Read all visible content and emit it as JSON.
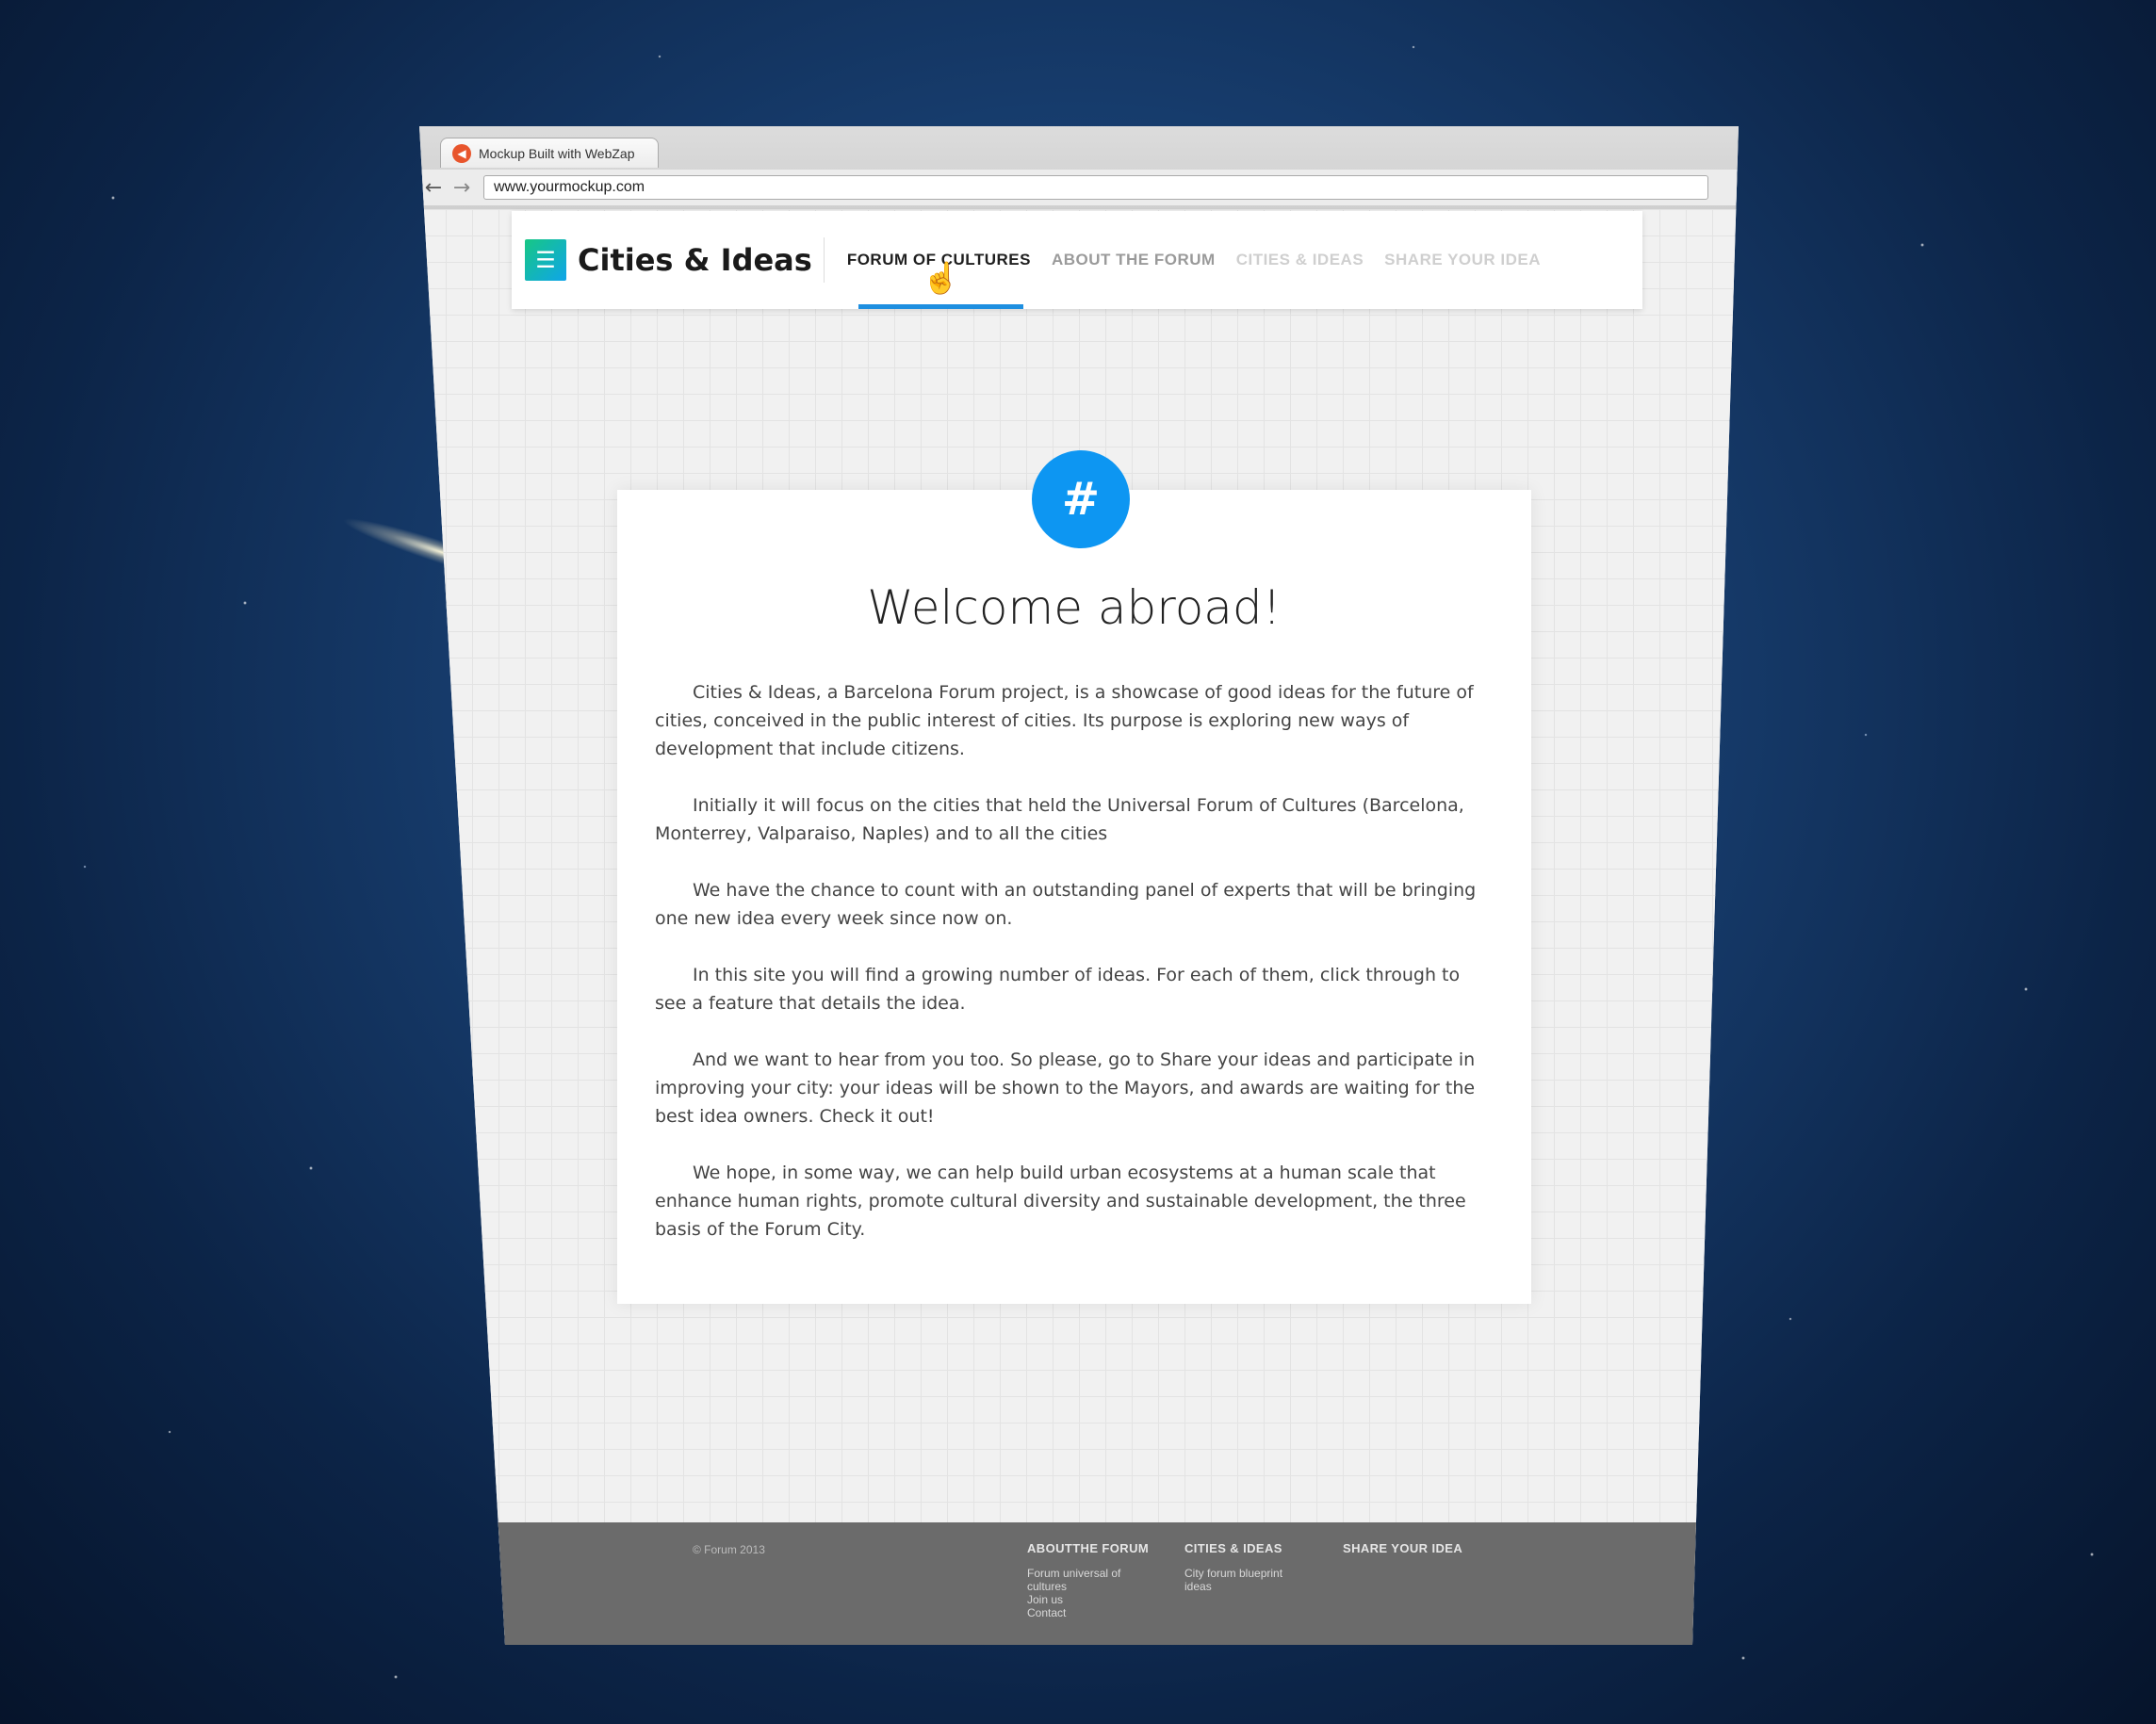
{
  "browser": {
    "tab_title": "Mockup Built with WebZap",
    "url": "www.yourmockup.com",
    "back_glyph": "←",
    "forward_glyph": "→"
  },
  "site": {
    "logo_text": "Cities & Ideas",
    "nav": [
      {
        "label": "FORUM OF CULTURES",
        "state": "active"
      },
      {
        "label": "ABOUT THE FORUM",
        "state": "normal"
      },
      {
        "label": "CITIES & IDEAS",
        "state": "faded"
      },
      {
        "label": "SHARE YOUR IDEA",
        "state": "faded"
      }
    ],
    "accent_color": "#1e8fe0"
  },
  "card": {
    "badge": "#",
    "heading": "Welcome abroad!",
    "paragraphs": [
      "Cities & Ideas, a Barcelona Forum project, is a showcase of good ideas for the future of cities, conceived in the public interest of cities. Its purpose is exploring new ways of development that include citizens.",
      "Initially it will focus on the cities that held the Universal Forum of Cultures (Barcelona, Monterrey, Valparaiso, Naples) and to all the cities",
      "We have the chance to count with an outstanding panel of experts that will be bringing one new idea every week since now on.",
      "In this site you will find a growing number of ideas. For each of them, click through to see a feature that details the idea.",
      "And we want to hear from you too. So please, go to Share your ideas and participate in improving your city: your ideas will be shown to the Mayors, and awards are waiting for the best idea owners. Check it out!",
      "We hope, in some way, we can help build urban ecosystems at a human scale that enhance human rights, promote cultural diversity and sustainable development, the three basis of the Forum City."
    ]
  },
  "footer": {
    "copyright": "© Forum 2013",
    "columns": [
      {
        "title": "ABOUTTHE FORUM",
        "links": [
          "Forum universal of cultures",
          "Join us",
          "Contact"
        ]
      },
      {
        "title": "CITIES & IDEAS",
        "links": [
          "City forum blueprint ideas"
        ]
      },
      {
        "title": "SHARE YOUR IDEA",
        "links": []
      }
    ]
  }
}
